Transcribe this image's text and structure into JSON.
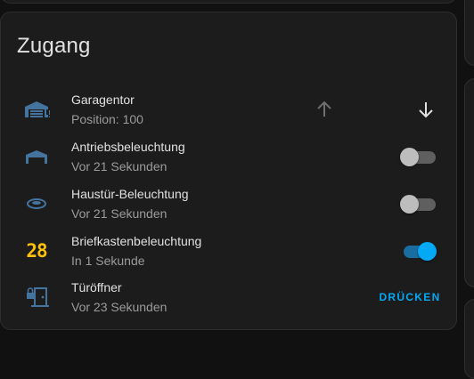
{
  "colors": {
    "icon_blue": "#44739e",
    "accent": "#03a9f4",
    "mailbox_yellow": "#ffc107"
  },
  "card": {
    "title": "Zugang",
    "rows": [
      {
        "icon": "garage-icon",
        "name": "Garagentor",
        "secondary": "Position: 100",
        "control": "cover",
        "up_icon": "arrow-up-icon",
        "down_icon": "arrow-down-icon"
      },
      {
        "icon": "garage-light-icon",
        "name": "Antriebsbeleuchtung",
        "secondary": "Vor 21 Sekunden",
        "control": "toggle",
        "state": "off"
      },
      {
        "icon": "ceiling-light-icon",
        "name": "Haustür-Beleuchtung",
        "secondary": "Vor 21 Sekunden",
        "control": "toggle",
        "state": "off"
      },
      {
        "icon": "mailbox-counter-icon",
        "icon_text": "28",
        "name": "Briefkastenbeleuchtung",
        "secondary": "In 1 Sekunde",
        "control": "toggle",
        "state": "on"
      },
      {
        "icon": "door-lock-icon",
        "name": "Türöffner",
        "secondary": "Vor 23 Sekunden",
        "control": "button",
        "button_label": "DRÜCKEN"
      }
    ]
  }
}
